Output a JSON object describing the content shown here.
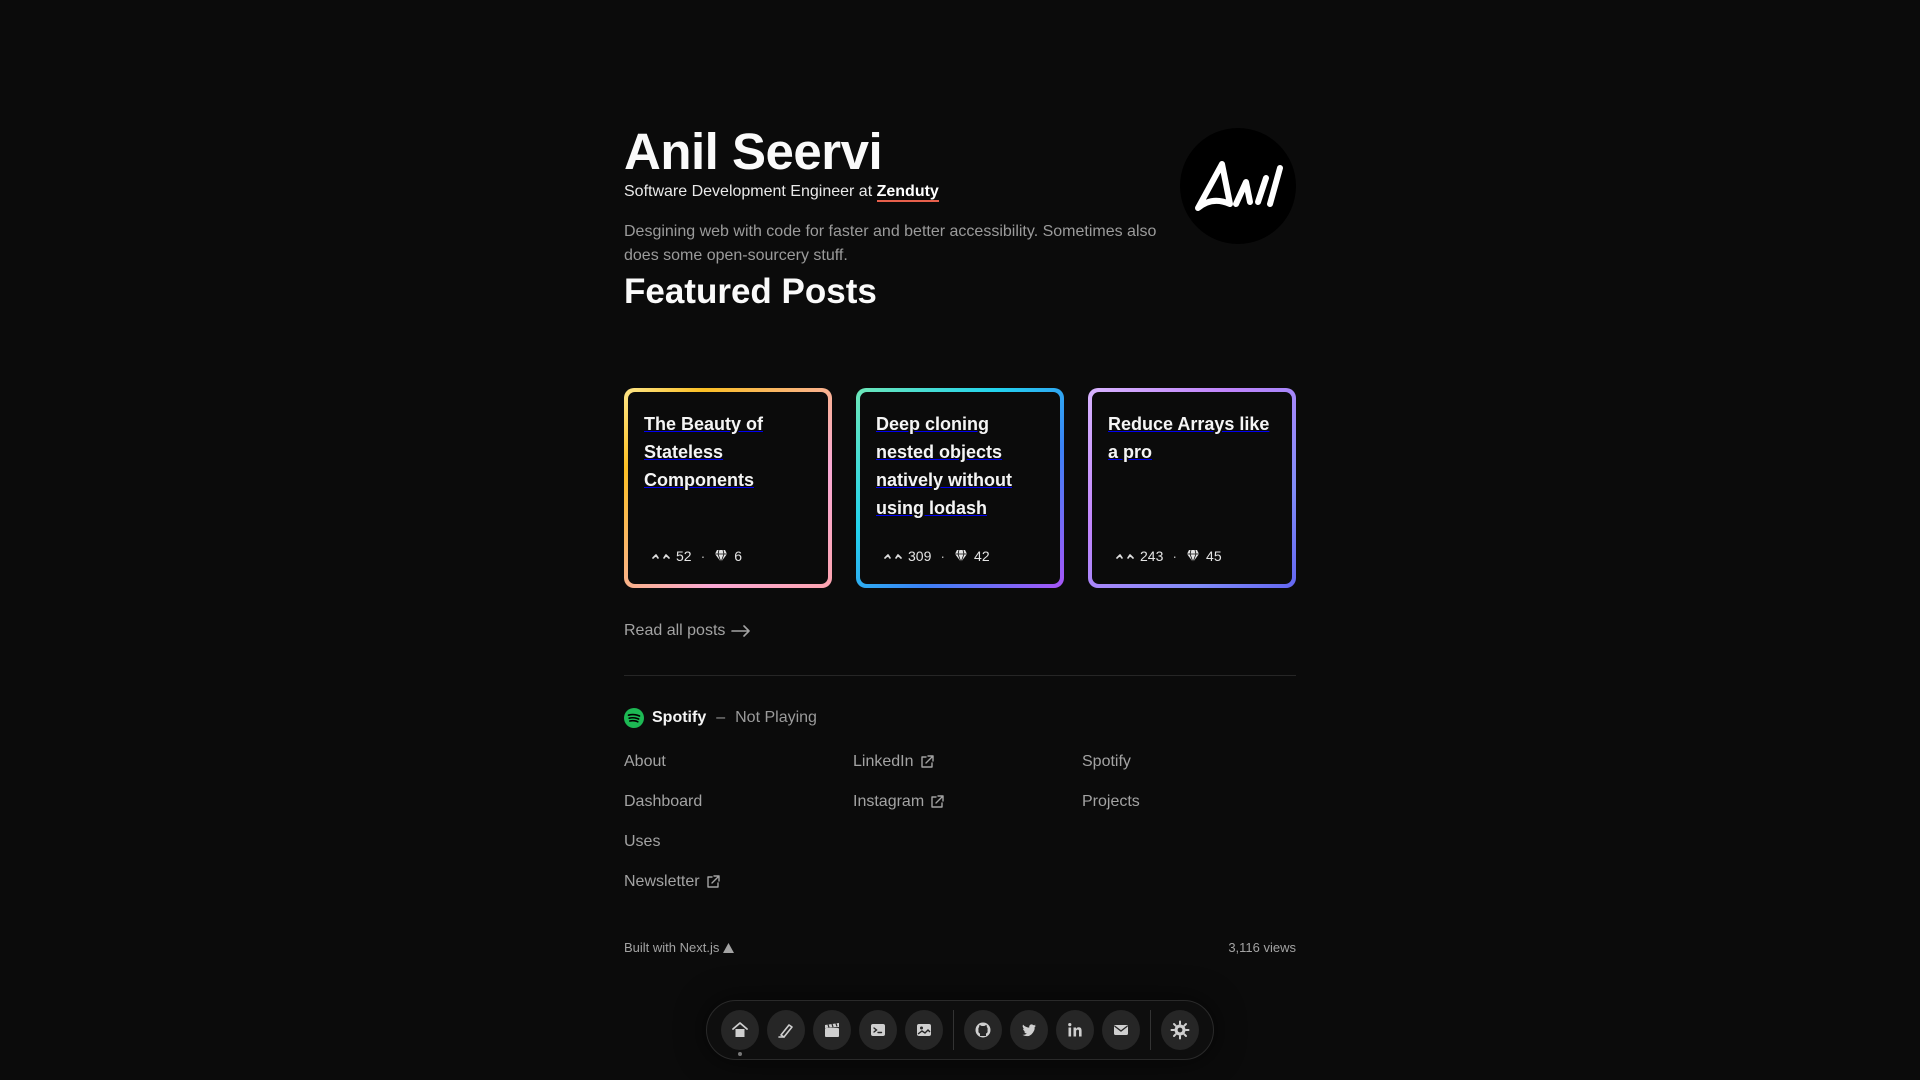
{
  "profile": {
    "name": "Anil Seervi",
    "role_prefix": "Software Development Engineer at",
    "company": "Zenduty",
    "bio": "Desgining web with code for faster and better accessibility. Sometimes also does some open-sourcery stuff."
  },
  "featured": {
    "title": "Featured Posts",
    "posts": [
      {
        "title": "The Beauty of Stateless Components",
        "views": "52",
        "likes": "6"
      },
      {
        "title": "Deep cloning nested objects natively without using lodash",
        "views": "309",
        "likes": "42"
      },
      {
        "title": "Reduce Arrays like a pro",
        "views": "243",
        "likes": "45"
      }
    ],
    "read_all": "Read all posts"
  },
  "spotify": {
    "label": "Spotify",
    "dash": "–",
    "status": "Not Playing"
  },
  "footer_links": {
    "col1": [
      "About",
      "Dashboard",
      "Uses",
      "Newsletter"
    ],
    "col2": [
      "LinkedIn",
      "Instagram"
    ],
    "col3": [
      "Spotify",
      "Projects"
    ]
  },
  "footer": {
    "built_with": "Built with Next.js",
    "views": "3,116 views"
  },
  "dock": {
    "items": [
      "home-icon",
      "writing-icon",
      "clapper-icon",
      "terminal-icon",
      "photos-icon",
      "github-icon",
      "twitter-icon",
      "linkedin-icon",
      "mail-icon",
      "settings-icon"
    ]
  },
  "colors": {
    "background": "#0b0b0b",
    "accent_underline": "#e8604c",
    "spotify_green": "#1db954"
  }
}
